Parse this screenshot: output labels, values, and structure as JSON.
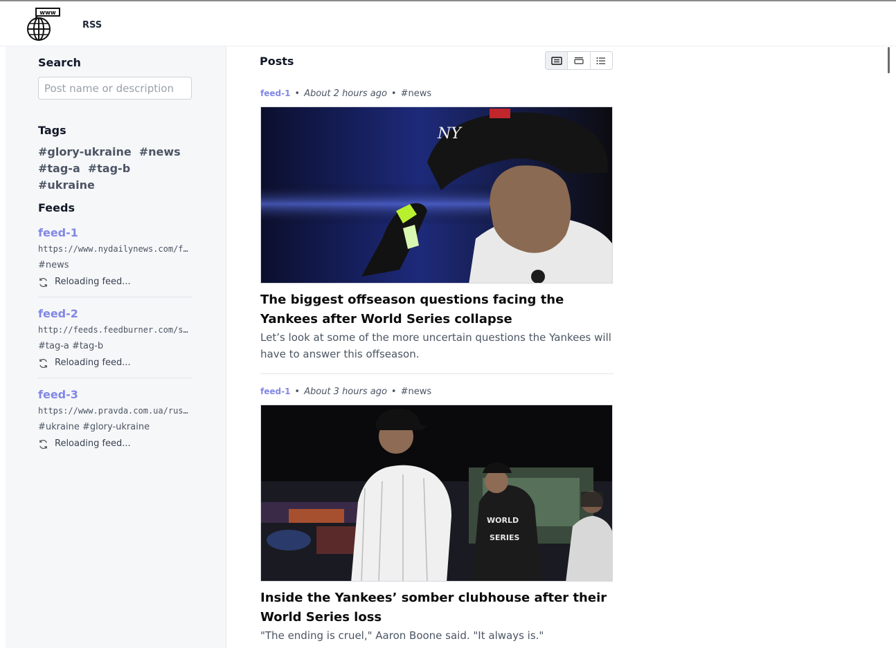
{
  "nav": {
    "logo_icon": "globe-www-icon",
    "rss_label": "RSS"
  },
  "sidebar": {
    "search_title": "Search",
    "search_placeholder": "Post name or description",
    "tags_title": "Tags",
    "tags": [
      "#glory-ukraine",
      "#news",
      "#tag-a",
      "#tag-b",
      "#ukraine"
    ],
    "feeds_title": "Feeds",
    "feeds": [
      {
        "name": "feed-1",
        "url": "https://www.nydailynews.com/feed/",
        "tags": "#news",
        "status": "Reloading feed..."
      },
      {
        "name": "feed-2",
        "url": "http://feeds.feedburner.com/simple",
        "tags": "#tag-a #tag-b",
        "status": "Reloading feed..."
      },
      {
        "name": "feed-3",
        "url": "https://www.pravda.com.ua/rus/rss/",
        "tags": "#ukraine #glory-ukraine",
        "status": "Reloading feed..."
      }
    ]
  },
  "main": {
    "posts_title": "Posts",
    "view_modes": [
      "card-view-icon",
      "compact-view-icon",
      "list-view-icon"
    ],
    "active_view": 0,
    "posts": [
      {
        "feed": "feed-1",
        "time": "About 2 hours ago",
        "tag": "#news",
        "title": "The biggest offseason questions facing the Yankees after World Series collapse",
        "description": "Let’s look at some of the more uncertain questions the Yankees will have to answer this offseason."
      },
      {
        "feed": "feed-1",
        "time": "About 3 hours ago",
        "tag": "#news",
        "title": "Inside the Yankees’ somber clubhouse after their World Series loss",
        "description": "\"The ending is cruel,\" Aaron Boone said. \"It always is.\""
      }
    ]
  },
  "colors": {
    "accent": "#8187e6",
    "sidebar_bg": "#f6f7f9"
  }
}
